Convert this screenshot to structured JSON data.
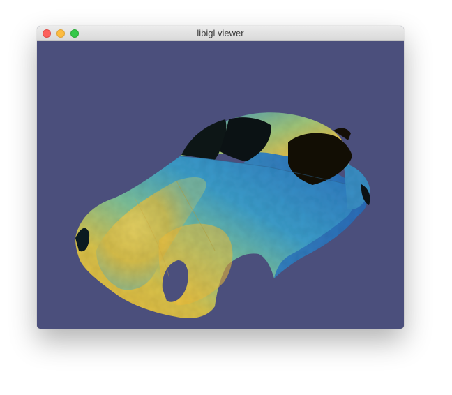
{
  "window": {
    "title": "libigl viewer"
  },
  "traffic_lights": {
    "close": "close-button",
    "minimize": "minimize-button",
    "zoom": "zoom-button"
  },
  "viewport": {
    "background_color": "#4b4f7c",
    "model": "car-body-mesh",
    "colormap": [
      "#2f6fc0",
      "#3aa3c9",
      "#7cc4a0",
      "#e2c04a",
      "#f0b63a"
    ]
  }
}
